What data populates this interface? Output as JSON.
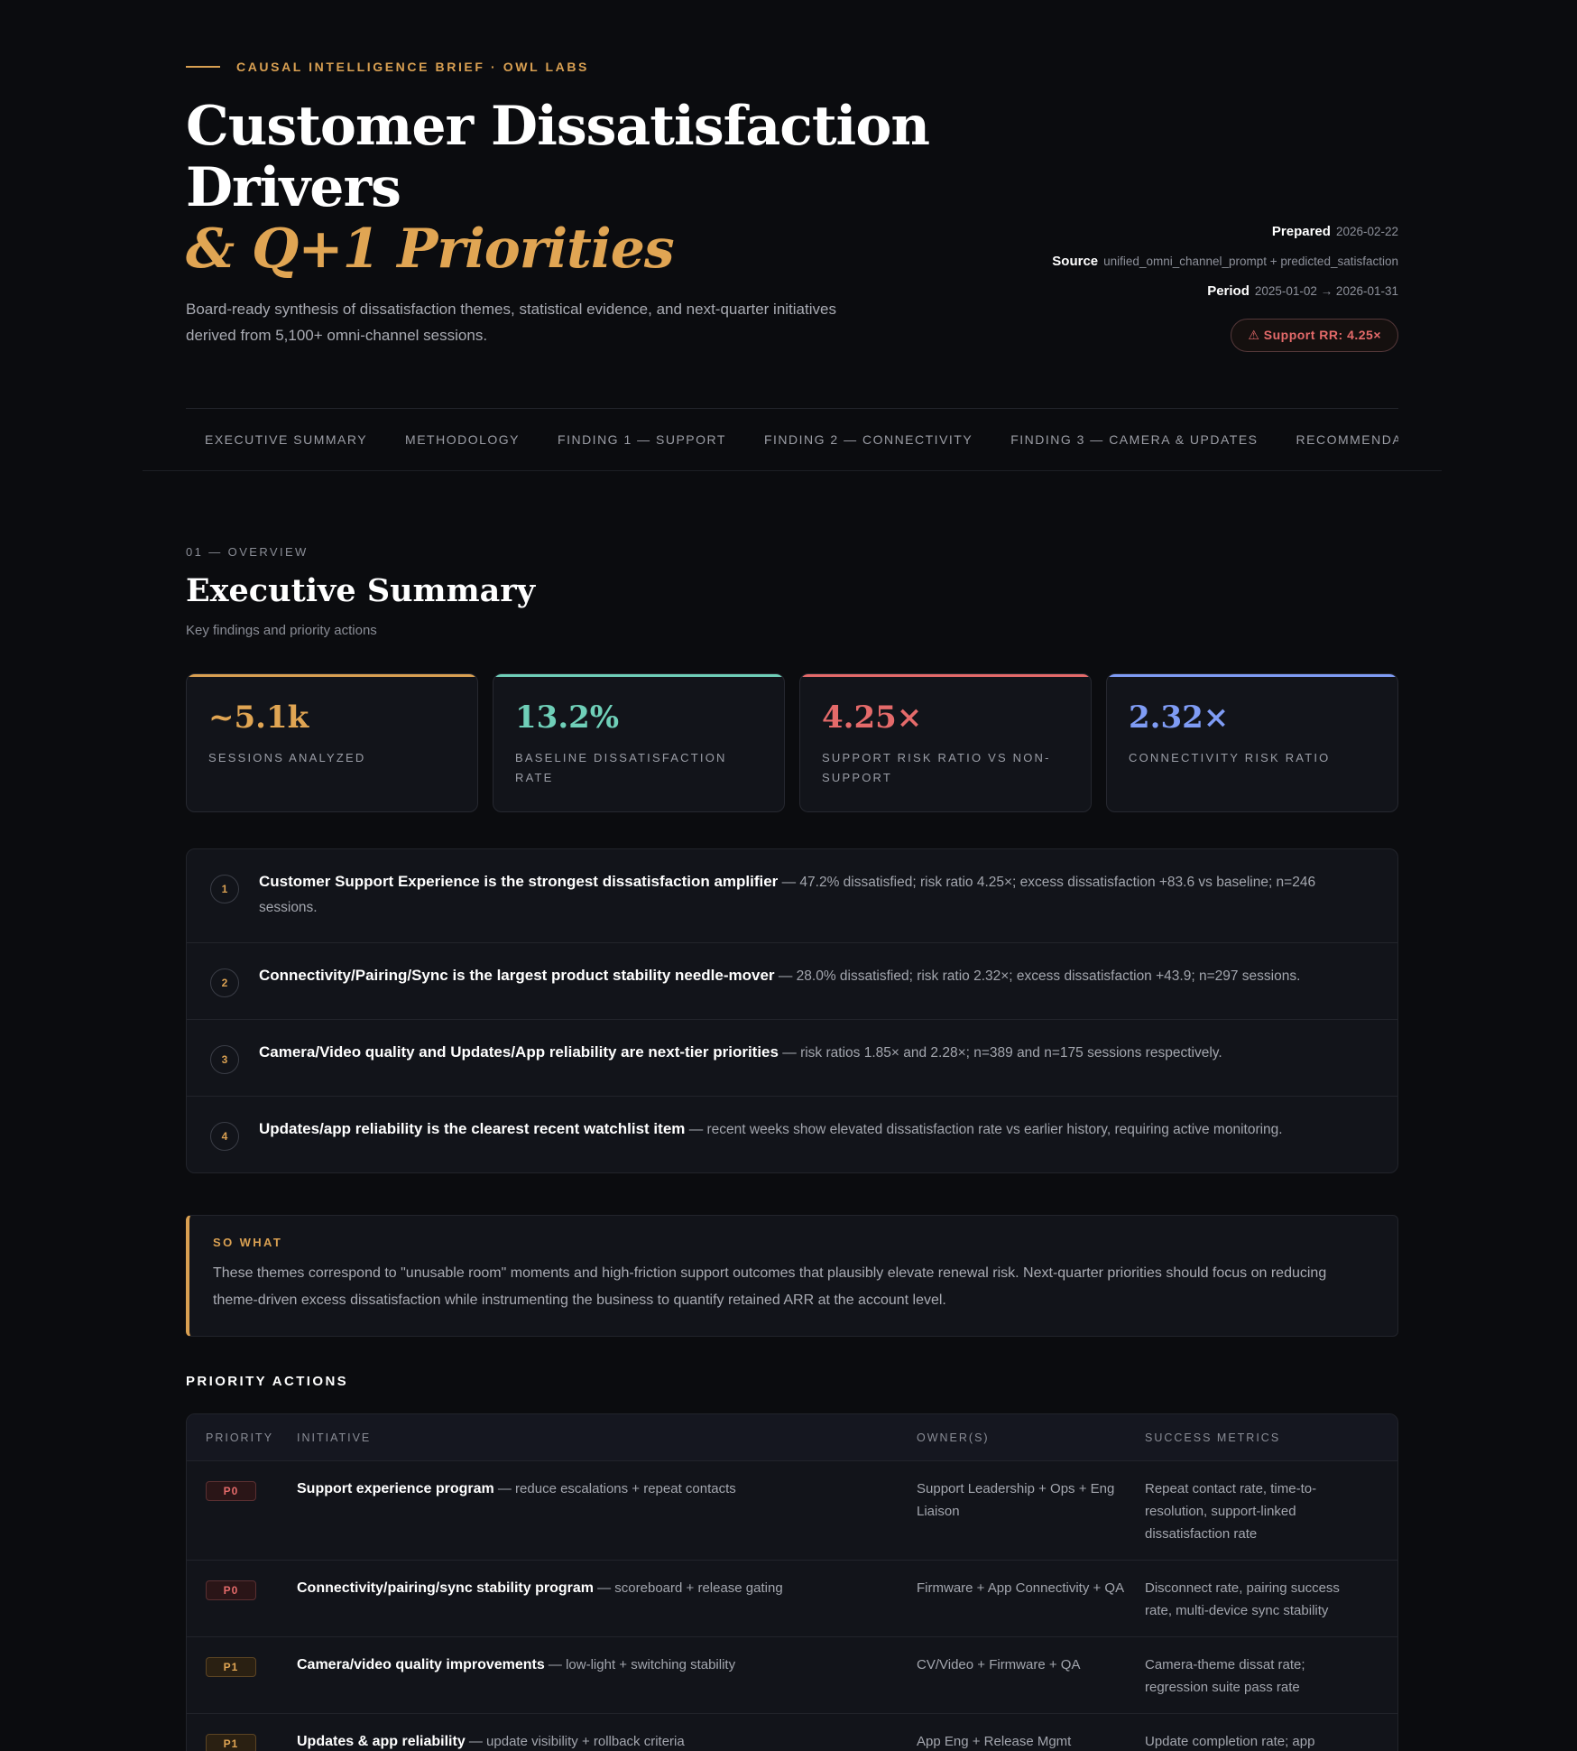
{
  "hero": {
    "eyebrow": "CAUSAL INTELLIGENCE BRIEF · OWL LABS",
    "title_line1": "Customer Dissatisfaction",
    "title_line2": "Drivers",
    "title_accent": "& Q+1 Priorities",
    "subtitle": "Board-ready synthesis of dissatisfaction themes, statistical evidence, and next-quarter initiatives derived from 5,100+ omni-channel sessions."
  },
  "meta": {
    "prepared_label": "Prepared",
    "prepared_value": "2026-02-22",
    "source_label": "Source",
    "source_value": "unified_omni_channel_prompt + predicted_satisfaction",
    "period_label": "Period",
    "period_value": "2025-01-02 → 2026-01-31",
    "badge": "⚠ Support RR: 4.25×"
  },
  "nav": {
    "tabs": [
      "EXECUTIVE SUMMARY",
      "METHODOLOGY",
      "FINDING 1 — SUPPORT",
      "FINDING 2 — CONNECTIVITY",
      "FINDING 3 — CAMERA & UPDATES",
      "RECOMMENDATIONS"
    ]
  },
  "section": {
    "eyebrow": "01 — OVERVIEW",
    "title": "Executive Summary",
    "subtitle": "Key findings and priority actions"
  },
  "kpis": [
    {
      "value": "~5.1k",
      "label": "SESSIONS ANALYZED",
      "color": "#d9a052"
    },
    {
      "value": "13.2%",
      "label": "BASELINE DISSATISFACTION RATE",
      "color": "#6fcfb8"
    },
    {
      "value": "4.25×",
      "label": "SUPPORT RISK RATIO VS NON-SUPPORT",
      "color": "#e46a6a"
    },
    {
      "value": "2.32×",
      "label": "CONNECTIVITY RISK RATIO",
      "color": "#7f9cf5"
    }
  ],
  "findings": [
    {
      "num": "1",
      "title": "Customer Support Experience is the strongest dissatisfaction amplifier",
      "text": " — 47.2% dissatisfied; risk ratio 4.25×; excess dissatisfaction +83.6 vs baseline; n=246 sessions."
    },
    {
      "num": "2",
      "title": "Connectivity/Pairing/Sync is the largest product stability needle-mover",
      "text": " — 28.0% dissatisfied; risk ratio 2.32×; excess dissatisfaction +43.9; n=297 sessions."
    },
    {
      "num": "3",
      "title": "Camera/Video quality and Updates/App reliability are next-tier priorities",
      "text": " — risk ratios 1.85× and 2.28×; n=389 and n=175 sessions respectively."
    },
    {
      "num": "4",
      "title": "Updates/app reliability is the clearest recent watchlist item",
      "text": " — recent weeks show elevated dissatisfaction rate vs earlier history, requiring active monitoring."
    }
  ],
  "sowhat": {
    "label": "SO WHAT",
    "text": "These themes correspond to \"unusable room\" moments and high-friction support outcomes that plausibly elevate renewal risk. Next-quarter priorities should focus on reducing theme-driven excess dissatisfaction while instrumenting the business to quantify retained ARR at the account level."
  },
  "priority": {
    "title": "PRIORITY ACTIONS",
    "headers": [
      "PRIORITY",
      "INITIATIVE",
      "OWNER(S)",
      "SUCCESS METRICS"
    ],
    "rows": [
      {
        "priority": "P0",
        "initiative": "Support experience program",
        "detail": " — reduce escalations + repeat contacts",
        "owners": "Support Leadership + Ops + Eng Liaison",
        "metrics": "Repeat contact rate, time-to-resolution, support-linked dissatisfaction rate"
      },
      {
        "priority": "P0",
        "initiative": "Connectivity/pairing/sync stability program",
        "detail": " — scoreboard + release gating",
        "owners": "Firmware + App Connectivity + QA",
        "metrics": "Disconnect rate, pairing success rate, multi-device sync stability"
      },
      {
        "priority": "P1",
        "initiative": "Camera/video quality improvements",
        "detail": " — low-light + switching stability",
        "owners": "CV/Video + Firmware + QA",
        "metrics": "Camera-theme dissat rate; regression suite pass rate"
      },
      {
        "priority": "P1",
        "initiative": "Updates & app reliability",
        "detail": " — update visibility + rollback criteria",
        "owners": "App Eng + Release Mgmt",
        "metrics": "Update completion rate; app"
      }
    ]
  }
}
